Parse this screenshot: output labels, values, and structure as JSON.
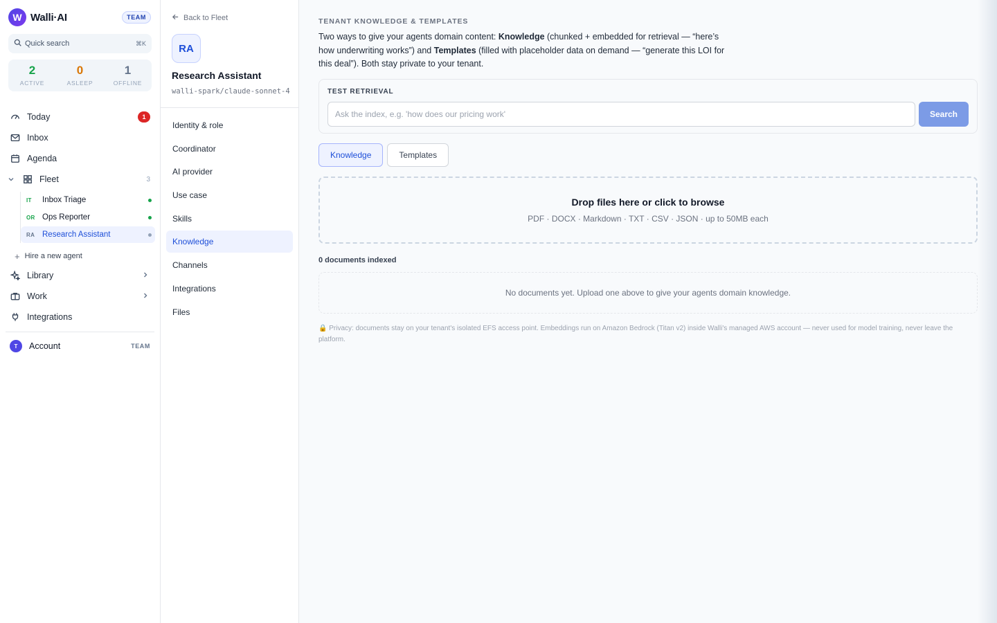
{
  "brand": {
    "logo_letter": "W",
    "name": "Walli·AI",
    "plan_badge": "TEAM"
  },
  "quick_search": {
    "label": "Quick search",
    "shortcut": "⌘K"
  },
  "stats": [
    {
      "value": "2",
      "label": "ACTIVE",
      "color": "#16a34a"
    },
    {
      "value": "0",
      "label": "ASLEEP",
      "color": "#d97706"
    },
    {
      "value": "1",
      "label": "OFFLINE",
      "color": "#64748b"
    }
  ],
  "nav": {
    "today": {
      "label": "Today",
      "icon": "gauge-icon",
      "badge": "1"
    },
    "inbox": {
      "label": "Inbox",
      "icon": "mail-icon"
    },
    "agenda": {
      "label": "Agenda",
      "icon": "calendar-icon"
    },
    "fleet": {
      "label": "Fleet",
      "icon": "grid-icon",
      "count": "3"
    },
    "library": {
      "label": "Library",
      "icon": "sparkle-icon"
    },
    "work": {
      "label": "Work",
      "icon": "briefcase-icon"
    },
    "integrations": {
      "label": "Integrations",
      "icon": "plug-icon"
    }
  },
  "fleet_agents": [
    {
      "initials": "IT",
      "name": "Inbox Triage",
      "status_color": "#16a34a",
      "initials_color": "#16a34a"
    },
    {
      "initials": "OR",
      "name": "Ops Reporter",
      "status_color": "#16a34a",
      "initials_color": "#16a34a"
    },
    {
      "initials": "RA",
      "name": "Research Assistant",
      "status_color": "#94a3b8",
      "initials_color": "#64748b"
    }
  ],
  "hire_label": "Hire a new agent",
  "account": {
    "initial": "T",
    "label": "Account",
    "plan": "TEAM"
  },
  "agent_panel": {
    "back_label": "Back to Fleet",
    "initials": "RA",
    "name": "Research Assistant",
    "model": "walli-spark/claude-sonnet-4",
    "settings_items": [
      {
        "label": "Identity & role"
      },
      {
        "label": "Coordinator"
      },
      {
        "label": "AI provider"
      },
      {
        "label": "Use case"
      },
      {
        "label": "Skills"
      },
      {
        "label": "Knowledge"
      },
      {
        "label": "Channels"
      },
      {
        "label": "Integrations"
      },
      {
        "label": "Files"
      }
    ]
  },
  "main": {
    "kicker": "TENANT KNOWLEDGE & TEMPLATES",
    "desc_1": "Two ways to give your agents domain content: ",
    "desc_knowledge": "Knowledge",
    "desc_2": " (chunked + embedded for retrieval — “here’s how underwriting works”) and ",
    "desc_templates": "Templates",
    "desc_3": " (filled with placeholder data on demand — “generate this LOI for this deal”). Both stay private to your tenant.",
    "retrieval": {
      "label": "TEST RETRIEVAL",
      "placeholder": "Ask the index, e.g. 'how does our pricing work'",
      "value": "",
      "button": "Search"
    },
    "tabs": [
      {
        "label": "Knowledge"
      },
      {
        "label": "Templates"
      }
    ],
    "dropzone": {
      "title": "Drop files here or click to browse",
      "hint": "PDF · DOCX · Markdown · TXT · CSV · JSON · up to 50MB each"
    },
    "doc_count": "0 documents indexed",
    "empty_state": "No documents yet. Upload one above to give your agents domain knowledge.",
    "privacy_icon": "🔒",
    "privacy": "Privacy: documents stay on your tenant's isolated EFS access point. Embeddings run on Amazon Bedrock (Titan v2) inside Walli's managed AWS account — never used for model training, never leave the platform."
  },
  "colors": {
    "accent": "#1d4ed8",
    "search_button": "#7c9be6",
    "badge_red": "#dc2626"
  }
}
